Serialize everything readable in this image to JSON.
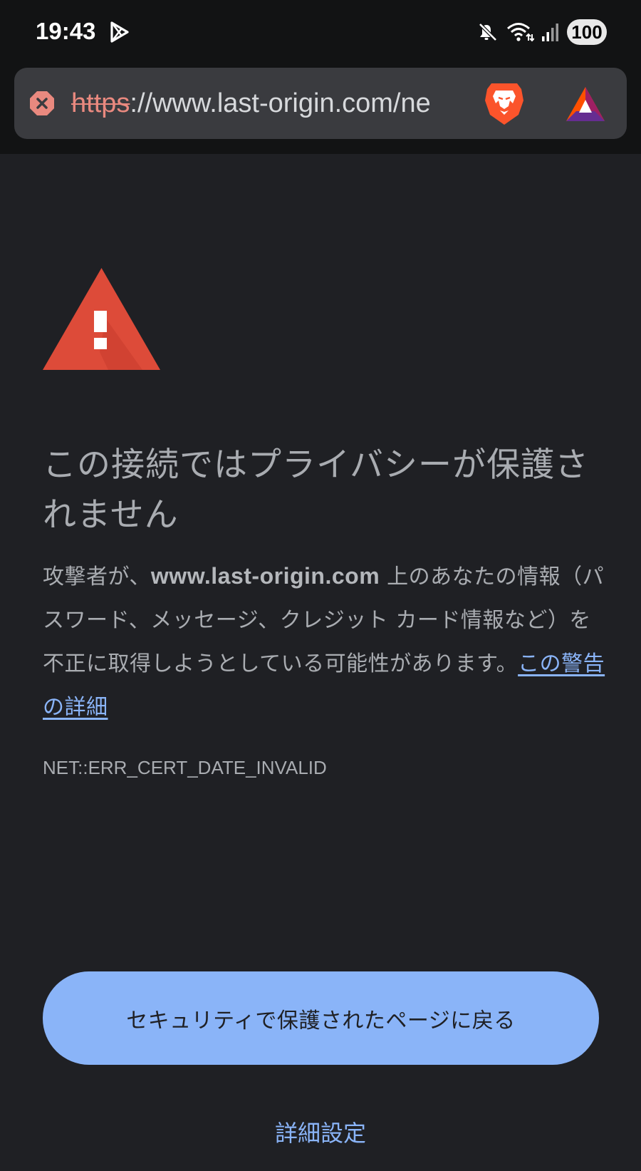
{
  "status_bar": {
    "time": "19:43",
    "battery": "100",
    "icons": [
      "play-store-icon",
      "mute-icon",
      "wifi-icon",
      "signal-icon",
      "battery-icon"
    ]
  },
  "url_bar": {
    "scheme": "https",
    "rest": "://www.last-origin.com/ne",
    "icons": [
      "not-secure-icon",
      "brave-shields-icon",
      "brave-rewards-icon"
    ]
  },
  "page": {
    "heading": "この接続ではプライバシーが保護されません",
    "body_before": "攻撃者が、",
    "host": "www.last-origin.com",
    "body_after": " 上のあなたの情報（パスワード、メッセージ、クレジット カード情報など）を不正に取得しようとしている可能性があります。",
    "learn_more": "この警告の詳細",
    "error_code": "NET::ERR_CERT_DATE_INVALID",
    "back_button": "セキュリティで保護されたページに戻る",
    "details": "詳細設定"
  },
  "colors": {
    "background": "#1f2024",
    "toolbar": "#121314",
    "omnibox": "#3a3b3f",
    "accent": "#8ab4f8",
    "warning_red": "#dd4b39",
    "text": "#a9acb1"
  }
}
